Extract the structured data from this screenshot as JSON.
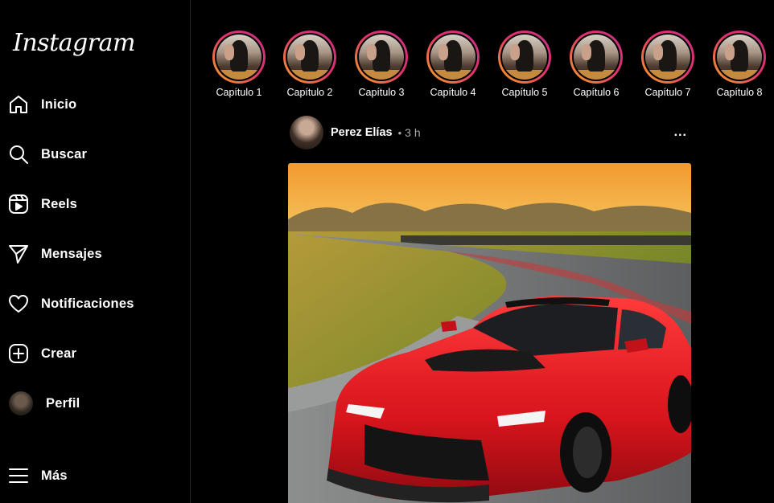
{
  "app": {
    "logo_text": "Instagram"
  },
  "sidebar": {
    "items": [
      {
        "label": "Inicio",
        "icon": "home-icon"
      },
      {
        "label": "Buscar",
        "icon": "search-icon"
      },
      {
        "label": "Reels",
        "icon": "reels-icon"
      },
      {
        "label": "Mensajes",
        "icon": "send-icon"
      },
      {
        "label": "Notificaciones",
        "icon": "heart-icon"
      },
      {
        "label": "Crear",
        "icon": "plus-square-icon"
      },
      {
        "label": "Perfil",
        "icon": "avatar"
      },
      {
        "label": "Más",
        "icon": "menu-icon"
      }
    ]
  },
  "stories": [
    {
      "label": "Capítulo 1"
    },
    {
      "label": "Capítulo 2"
    },
    {
      "label": "Capítulo 3"
    },
    {
      "label": "Capítulo 4"
    },
    {
      "label": "Capítulo 5"
    },
    {
      "label": "Capítulo 6"
    },
    {
      "label": "Capítulo 7"
    },
    {
      "label": "Capítulo 8"
    }
  ],
  "post": {
    "username": "Perez Elías",
    "separator": "•",
    "time": "3 h",
    "more_label": "..."
  },
  "colors": {
    "background": "#000000",
    "story_ring_start": "#f5a623",
    "story_ring_end": "#c13584",
    "car_red": "#d8141c"
  }
}
